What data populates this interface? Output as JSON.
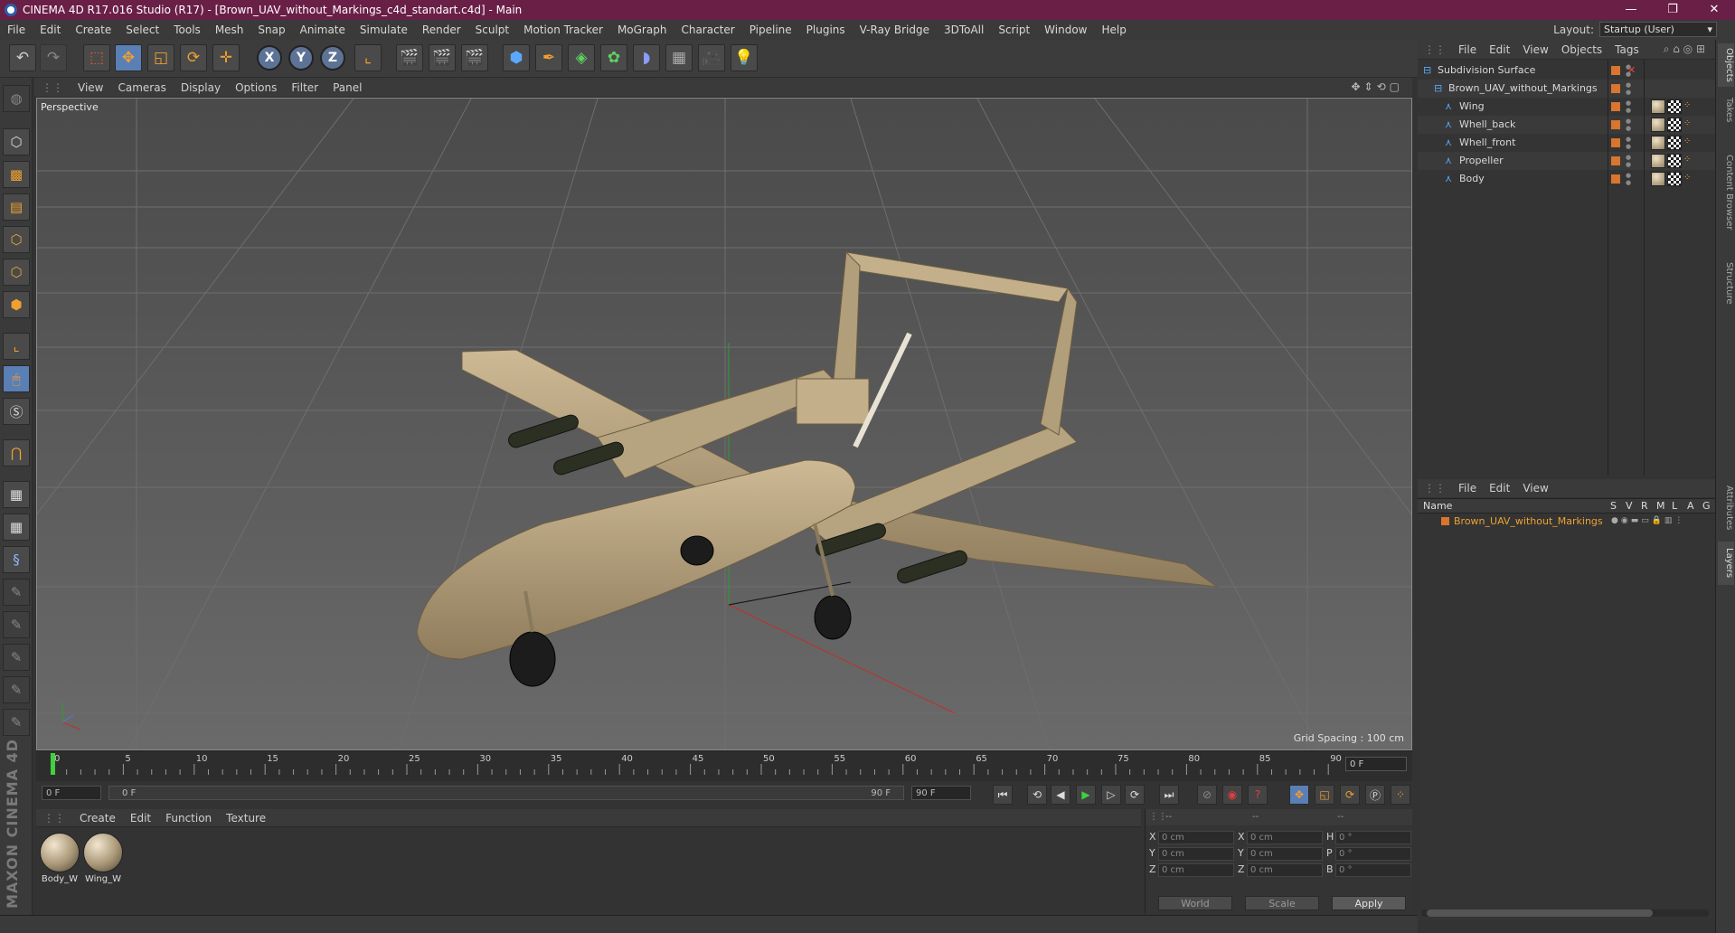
{
  "window": {
    "title": "CINEMA 4D R17.016 Studio (R17) - [Brown_UAV_without_Markings_c4d_standart.c4d] - Main",
    "controls": [
      "—",
      "❐",
      "✕"
    ]
  },
  "menu": {
    "items": [
      "File",
      "Edit",
      "Create",
      "Select",
      "Tools",
      "Mesh",
      "Snap",
      "Animate",
      "Simulate",
      "Render",
      "Sculpt",
      "Motion Tracker",
      "MoGraph",
      "Character",
      "Pipeline",
      "Plugins",
      "V-Ray Bridge",
      "3DToAll",
      "Script",
      "Window",
      "Help"
    ],
    "layout_label": "Layout:",
    "layout_value": "Startup (User)"
  },
  "toolbar": {
    "axis_x": "X",
    "axis_y": "Y",
    "axis_z": "Z"
  },
  "viewport": {
    "menu": [
      "View",
      "Cameras",
      "Display",
      "Options",
      "Filter",
      "Panel"
    ],
    "camera_label": "Perspective",
    "grid_spacing": "Grid Spacing : 100 cm"
  },
  "timeline": {
    "ticks": [
      "0",
      "5",
      "10",
      "15",
      "20",
      "25",
      "30",
      "35",
      "40",
      "45",
      "50",
      "55",
      "60",
      "65",
      "70",
      "75",
      "80",
      "85",
      "90"
    ],
    "current_frame": "0 F"
  },
  "transport": {
    "start_field": "0 F",
    "range_start": "0 F",
    "range_end": "90 F",
    "end_field": "90 F"
  },
  "materials": {
    "menu": [
      "Create",
      "Edit",
      "Function",
      "Texture"
    ],
    "items": [
      {
        "label": "Body_W"
      },
      {
        "label": "Wing_W"
      }
    ]
  },
  "coords": {
    "header_a": "--",
    "header_b": "--",
    "header_c": "--",
    "rows": [
      {
        "a": "X",
        "av": "0 cm",
        "b": "X",
        "bv": "0 cm",
        "c": "H",
        "cv": "0 °"
      },
      {
        "a": "Y",
        "av": "0 cm",
        "b": "Y",
        "bv": "0 cm",
        "c": "P",
        "cv": "0 °"
      },
      {
        "a": "Z",
        "av": "0 cm",
        "b": "Z",
        "bv": "0 cm",
        "c": "B",
        "cv": "0 °"
      }
    ],
    "mode": "World",
    "scale": "Scale",
    "apply": "Apply"
  },
  "object_manager": {
    "menu": [
      "File",
      "Edit",
      "View",
      "Objects",
      "Tags"
    ],
    "objects": [
      {
        "name": "Subdivision Surface",
        "indent": 0
      },
      {
        "name": "Brown_UAV_without_Markings",
        "indent": 1
      },
      {
        "name": "Wing",
        "indent": 2
      },
      {
        "name": "Whell_back",
        "indent": 2
      },
      {
        "name": "Whell_front",
        "indent": 2
      },
      {
        "name": "Propeller",
        "indent": 2
      },
      {
        "name": "Body",
        "indent": 2
      }
    ]
  },
  "layer_manager": {
    "menu": [
      "File",
      "Edit",
      "View"
    ],
    "columns": [
      "Name",
      "S",
      "V",
      "R",
      "M",
      "L",
      "A",
      "G"
    ],
    "layers": [
      {
        "name": "Brown_UAV_without_Markings",
        "color": "#d9752e"
      }
    ]
  },
  "side_tabs": [
    "Objects",
    "Takes",
    "Content Browser",
    "Structure",
    "Attributes",
    "Layers"
  ],
  "branding": "MAXON CINEMA 4D"
}
